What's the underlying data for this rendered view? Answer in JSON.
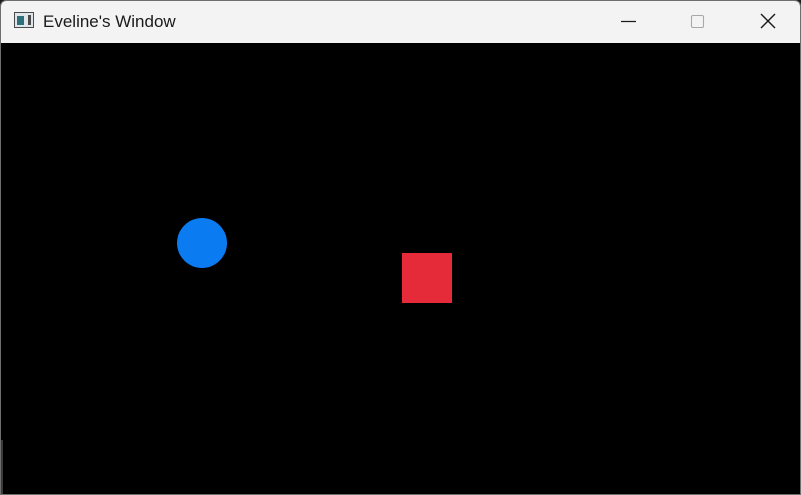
{
  "window": {
    "title": "Eveline's Window",
    "app_icon": "window-app-icon",
    "controls": {
      "minimize_icon": "minimize-icon",
      "maximize_icon": "maximize-icon",
      "close_icon": "close-icon"
    }
  },
  "canvas": {
    "background": "#000000",
    "shapes": [
      {
        "kind": "circle",
        "color": "#0a7bf0"
      },
      {
        "kind": "square",
        "color": "#e52a3a"
      }
    ]
  }
}
